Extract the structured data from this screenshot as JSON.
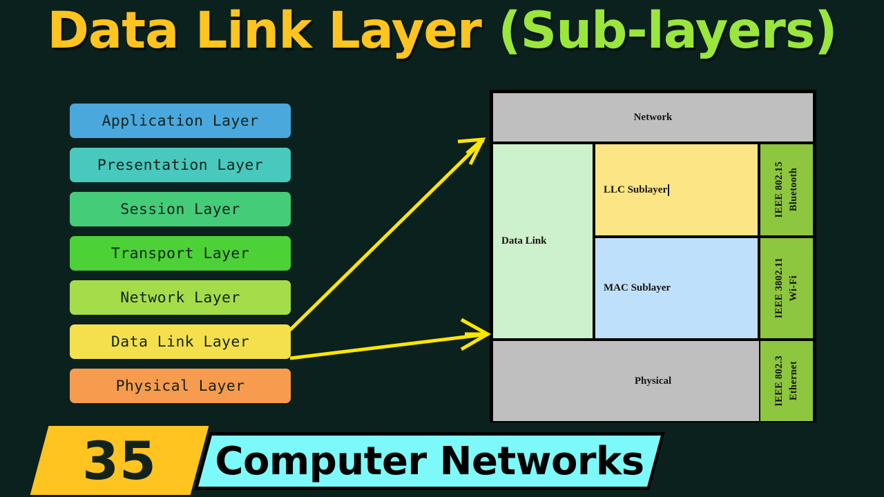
{
  "background_color": "#0b211d",
  "title": {
    "main": "Data Link Layer",
    "sub": "(Sub-layers)",
    "main_color": "#ffc41f",
    "sub_color": "#9ae63c"
  },
  "osi_stack": {
    "layers": [
      {
        "label": "Application Layer",
        "color": "#4aa8dd"
      },
      {
        "label": "Presentation Layer",
        "color": "#49c8bd"
      },
      {
        "label": "Session Layer",
        "color": "#45cc79"
      },
      {
        "label": "Transport Layer",
        "color": "#4cd137"
      },
      {
        "label": "Network Layer",
        "color": "#a5dd4a"
      },
      {
        "label": "Data Link Layer",
        "color": "#f4e04d"
      },
      {
        "label": "Physical Layer",
        "color": "#f79b4e"
      }
    ]
  },
  "diagram": {
    "network": {
      "label": "Network",
      "color": "#bfbfbf"
    },
    "data_link": {
      "label": "Data Link",
      "color": "#cdf0cd"
    },
    "llc": {
      "label": "LLC Sublayer",
      "color": "#fce584",
      "has_text_cursor": true
    },
    "mac": {
      "label": "MAC Sublayer",
      "color": "#bfe0fb"
    },
    "physical": {
      "label": "Physical",
      "color": "#bfbfbf"
    },
    "standards": [
      {
        "standard": "IEEE 802.15",
        "technology": "Bluetooth",
        "color": "#8dc63f"
      },
      {
        "standard": "IEEE 3802.11",
        "technology": "Wi-Fi",
        "color": "#8dc63f"
      },
      {
        "standard": "IEEE 802.3",
        "technology": "Ethernet",
        "color": "#8dc63f"
      }
    ]
  },
  "arrows": {
    "color": "#ffe600",
    "count": 2,
    "description_upper": "Data Link Layer to Data Link block (upper)",
    "description_lower": "Data Link Layer to Physical block (lower)"
  },
  "footer": {
    "number": "35",
    "number_color": "#ffc41f",
    "title": "Computer Networks",
    "title_color": "#7df9f9"
  }
}
